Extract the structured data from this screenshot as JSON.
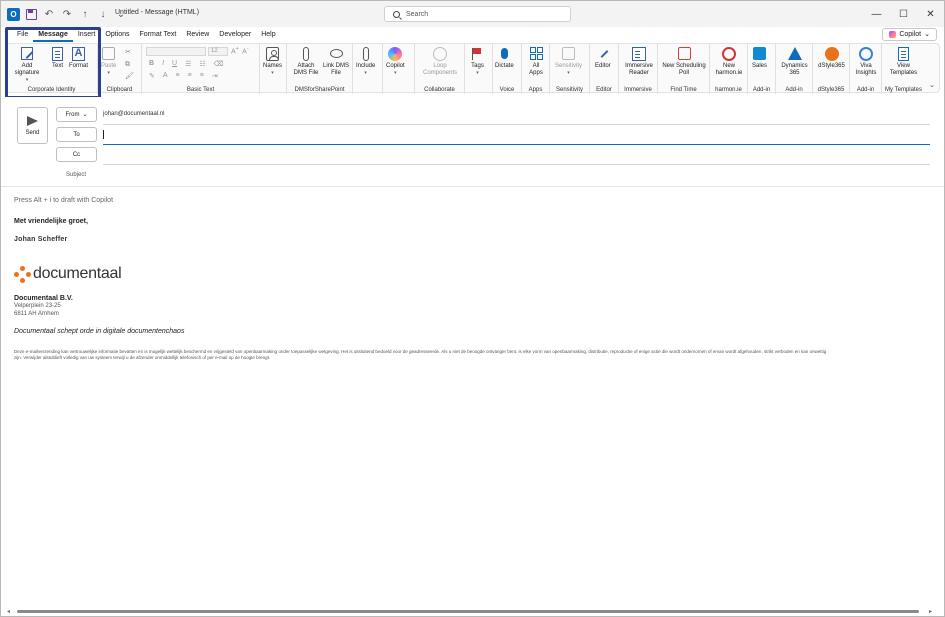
{
  "window": {
    "title": "Untitled  -  Message (HTML)",
    "search_placeholder": "Search"
  },
  "tabs": [
    "File",
    "Message",
    "Insert",
    "Options",
    "Format Text",
    "Review",
    "Developer",
    "Help"
  ],
  "active_tab": "Message",
  "copilot_button": "Copilot",
  "ribbon": {
    "corporate_identity": {
      "label": "Corporate Identity",
      "add_signature": "Add signature",
      "text": "Text",
      "format": "Format"
    },
    "clipboard": {
      "label": "Clipboard",
      "paste": "Paste"
    },
    "basic_text": {
      "label": "Basic Text",
      "font_size": "12"
    },
    "names": {
      "label": "",
      "names": "Names"
    },
    "dms": {
      "label": "DMSforSharePoint",
      "attach": "Attach DMS File",
      "link": "Link DMS File"
    },
    "include": {
      "include": "Include"
    },
    "copilot": {
      "copilot": "Copilot"
    },
    "collaborate": {
      "label": "Collaborate",
      "loop": "Loop Components"
    },
    "tags": {
      "tags": "Tags"
    },
    "voice": {
      "label": "Voice",
      "dictate": "Dictate"
    },
    "apps": {
      "label": "Apps",
      "all_apps": "All Apps"
    },
    "sensitivity": {
      "label": "Sensitivity",
      "sensitivity": "Sensitivity"
    },
    "editor": {
      "label": "Editor",
      "editor": "Editor"
    },
    "immersive": {
      "label": "Immersive",
      "reader": "Immersive Reader"
    },
    "find_time": {
      "label": "Find Time",
      "poll": "New Scheduling Poll"
    },
    "harmon": {
      "label": "harmon.ie",
      "new": "New harmon.ie"
    },
    "addin1": {
      "label": "Add-in",
      "sales": "Sales"
    },
    "addin2": {
      "label": "Add-in",
      "dynamics": "Dynamics 365"
    },
    "dstyle": {
      "label": "dStyle365",
      "dstyle": "dStyle365"
    },
    "addin3": {
      "label": "Add-in",
      "viva": "Viva Insights"
    },
    "templates": {
      "label": "My Templates",
      "view": "View Templates"
    }
  },
  "compose": {
    "send": "Send",
    "from_button": "From",
    "from_address": "johan@documentaal.nl",
    "to_button": "To",
    "cc_button": "Cc",
    "subject_label": "Subject"
  },
  "body": {
    "hint": "Press Alt + i to draft with Copilot",
    "greeting": "Met vriendelijke groet,",
    "signer": "Johan Scheffer",
    "logo_text": "documentaal",
    "company": "Documentaal B.V.",
    "address_line1": "Velperplein 23-25",
    "address_line2": "6811 AH  Arnhem",
    "tagline": "Documentaal schept orde in digitale documentenchaos",
    "disclaimer": "Deze e-mailverzending kan vertrouwelijke informatie bevatten en is mogelijk wettelijk beschermd en vrijgesteld van openbaarmaking onder toepasselijke wetgeving. Het is uitsluitend bedoeld voor de geadresseerde. Als u niet de beoogde ontvanger bent, is elke vorm van openbaarmaking, distributie, reproductie of enige actie die wordt ondernomen of ervan wordt afgehouden, strikt verboden en kan onwettig zijn. Verwijder alstublieft volledig van uw systeem terwijl u de afzender onmiddellijk telefonisch of per e-mail op de hoogte brengt."
  },
  "colors": {
    "accent": "#0f6cbd",
    "highlight": "#2c3e8f",
    "logo_orange": "#e8731c"
  }
}
